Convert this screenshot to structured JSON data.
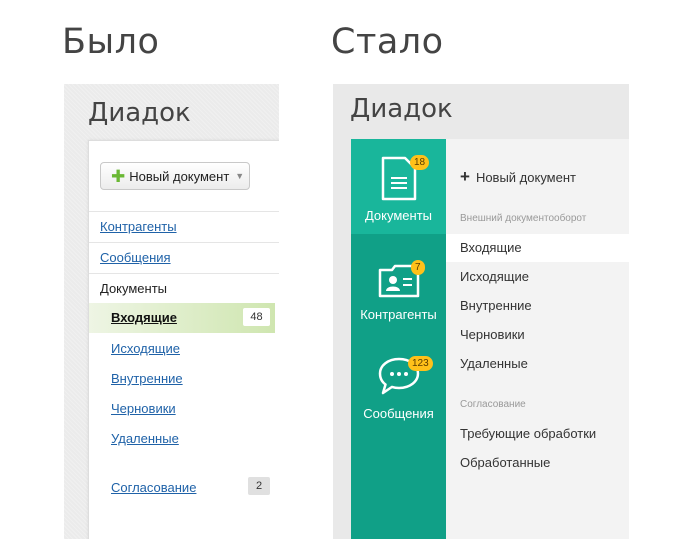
{
  "headings": {
    "before": "Было",
    "after": "Стало"
  },
  "old": {
    "logo": "Диадок",
    "new_document": "Новый документ",
    "links": [
      "Контрагенты",
      "Сообщения"
    ],
    "documents_label": "Документы",
    "active_item": {
      "label": "Входящие",
      "count": "48"
    },
    "items": [
      "Исходящие",
      "Внутренние",
      "Черновики",
      "Удаленные"
    ],
    "approval": {
      "label": "Согласование",
      "count": "2"
    },
    "colors": {
      "link": "#1f62a8",
      "active_bg": "#cfe6b0",
      "plus": "#6ab834"
    }
  },
  "new": {
    "logo": "Диадок",
    "sidebar": [
      {
        "label": "Документы",
        "badge": "18",
        "icon": "document-icon"
      },
      {
        "label": "Контрагенты",
        "badge": "7",
        "icon": "contact-card-icon"
      },
      {
        "label": "Сообщения",
        "badge": "123",
        "icon": "chat-bubble-icon"
      }
    ],
    "new_document": "Новый документ",
    "section_external": "Внешний документооборот",
    "external_items": [
      "Входящие",
      "Исходящие",
      "Внутренние",
      "Черновики",
      "Удаленные"
    ],
    "section_approval": "Согласование",
    "approval_items": [
      "Требующие обработки",
      "Обработанные"
    ],
    "colors": {
      "sidebar": "#10a087",
      "sidebar_active": "#19b69b",
      "badge": "#ffc11a"
    }
  }
}
